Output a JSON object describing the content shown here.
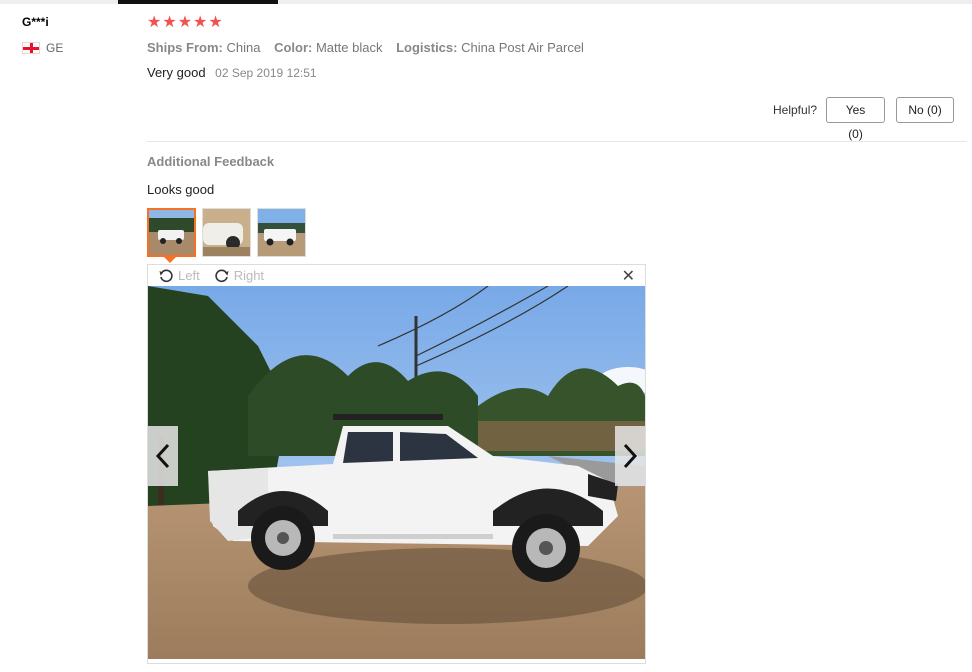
{
  "reviewer": {
    "name": "G***i",
    "country": "GE"
  },
  "rating": {
    "stars": 5,
    "max": 5
  },
  "meta": [
    {
      "label": "Ships From:",
      "value": "China"
    },
    {
      "label": "Color:",
      "value": "Matte black"
    },
    {
      "label": "Logistics:",
      "value": "China Post Air Parcel"
    }
  ],
  "review": {
    "text": "Very good",
    "date": "02 Sep 2019 12:51"
  },
  "helpful": {
    "question": "Helpful?",
    "yes_label": "Yes (0)",
    "no_label": "No (0)"
  },
  "additional": {
    "title": "Additional Feedback",
    "text": "Looks good"
  },
  "viewer": {
    "rotate_left": "Left",
    "rotate_right": "Right"
  },
  "colors": {
    "star": "#f0524f",
    "active_border": "#f57224"
  },
  "icons": {
    "star": "star-icon",
    "flag": "georgia-flag-icon",
    "rotate_left": "rotate-left-icon",
    "rotate_right": "rotate-right-icon",
    "close": "close-icon",
    "prev": "chevron-left-icon",
    "next": "chevron-right-icon"
  }
}
